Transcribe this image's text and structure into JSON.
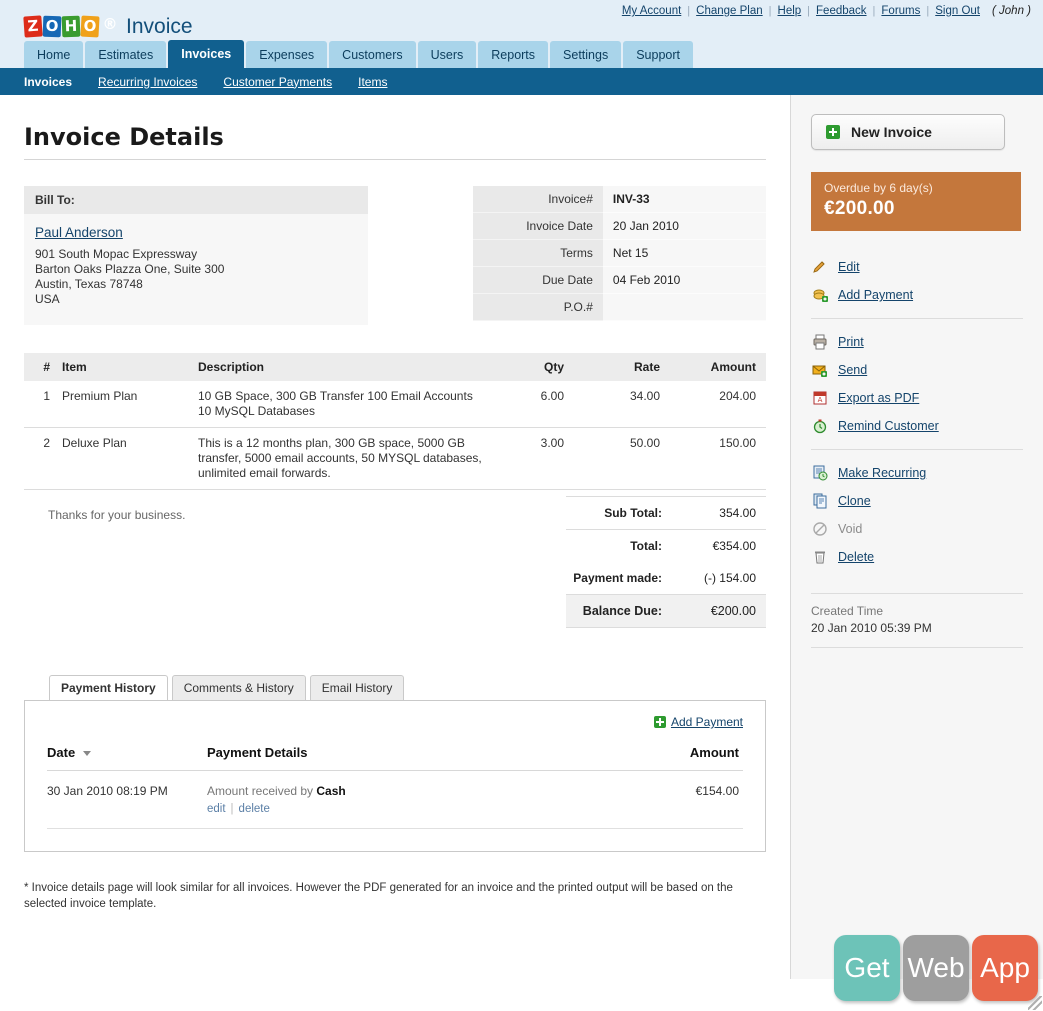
{
  "header": {
    "logo": {
      "tiles": [
        "Z",
        "O",
        "H",
        "O"
      ],
      "reg": "®",
      "word": "Invoice"
    },
    "top_links": [
      {
        "label": "My Account"
      },
      {
        "label": "Change Plan"
      },
      {
        "label": "Help"
      },
      {
        "label": "Feedback"
      },
      {
        "label": "Forums"
      },
      {
        "label": "Sign Out"
      }
    ],
    "user": "( John )",
    "tabs": [
      {
        "label": "Home",
        "active": false
      },
      {
        "label": "Estimates",
        "active": false
      },
      {
        "label": "Invoices",
        "active": true
      },
      {
        "label": "Expenses",
        "active": false
      },
      {
        "label": "Customers",
        "active": false
      },
      {
        "label": "Users",
        "active": false
      },
      {
        "label": "Reports",
        "active": false
      },
      {
        "label": "Settings",
        "active": false
      },
      {
        "label": "Support",
        "active": false
      }
    ],
    "subnav": [
      {
        "label": "Invoices",
        "active": true
      },
      {
        "label": "Recurring Invoices",
        "active": false
      },
      {
        "label": "Customer Payments",
        "active": false
      },
      {
        "label": "Items",
        "active": false
      }
    ]
  },
  "main": {
    "page_title": "Invoice Details",
    "bill_to": {
      "heading": "Bill To:",
      "customer": "Paul Anderson",
      "address_lines": [
        "901 South Mopac Expressway",
        "Barton Oaks Plazza One, Suite 300",
        "Austin, Texas 78748",
        "USA"
      ]
    },
    "meta": [
      {
        "key": "Invoice#",
        "value": "INV-33",
        "strong": true
      },
      {
        "key": "Invoice Date",
        "value": "20 Jan 2010",
        "strong": false
      },
      {
        "key": "Terms",
        "value": "Net 15",
        "strong": false
      },
      {
        "key": "Due Date",
        "value": "04 Feb 2010",
        "strong": false
      },
      {
        "key": "P.O.#",
        "value": "",
        "strong": false
      }
    ],
    "items_header": [
      "#",
      "Item",
      "Description",
      "Qty",
      "Rate",
      "Amount"
    ],
    "items": [
      {
        "num": "1",
        "item": "Premium Plan",
        "description": "10 GB Space, 300 GB Transfer 100 Email Accounts 10 MySQL Databases",
        "qty": "6.00",
        "rate": "34.00",
        "amount": "204.00"
      },
      {
        "num": "2",
        "item": "Deluxe Plan",
        "description": "This is a 12 months plan, 300 GB space, 5000 GB transfer, 5000 email accounts, 50 MYSQL databases, unlimited email forwards.",
        "qty": "3.00",
        "rate": "50.00",
        "amount": "150.00"
      }
    ],
    "thanks_note": "Thanks for your business.",
    "totals": [
      {
        "key": "Sub Total:",
        "value": "354.00"
      },
      {
        "key": "Total:",
        "value": "€354.00"
      },
      {
        "key": "Payment made:",
        "value": "(-) 154.00"
      },
      {
        "key": "Balance Due:",
        "value": "€200.00"
      }
    ],
    "panel_tabs": [
      {
        "label": "Payment History",
        "active": true
      },
      {
        "label": "Comments & History",
        "active": false
      },
      {
        "label": "Email History",
        "active": false
      }
    ],
    "add_payment_label": "Add Payment",
    "payment_table": {
      "headers": [
        "Date",
        "Payment Details",
        "Amount"
      ],
      "rows": [
        {
          "date": "30 Jan 2010 08:19 PM",
          "details_prefix": "Amount received by ",
          "details_method": "Cash",
          "edit": "edit",
          "delete": "delete",
          "amount": "€154.00"
        }
      ]
    },
    "footnote": "* Invoice details page will look similar for all invoices. However the PDF generated for an invoice and the printed output will be based on the selected invoice template."
  },
  "sidebar": {
    "new_invoice_label": "New Invoice",
    "status": {
      "line1": "Overdue by 6 day(s)",
      "line2": "€200.00"
    },
    "actions_group1": [
      {
        "label": "Edit",
        "icon": "pencil-icon",
        "disabled": false
      },
      {
        "label": "Add Payment",
        "icon": "money-add-icon",
        "disabled": false
      }
    ],
    "actions_group2": [
      {
        "label": "Print",
        "icon": "printer-icon",
        "disabled": false
      },
      {
        "label": "Send",
        "icon": "envelope-icon",
        "disabled": false
      },
      {
        "label": "Export as PDF",
        "icon": "pdf-icon",
        "disabled": false
      },
      {
        "label": "Remind Customer",
        "icon": "clock-icon",
        "disabled": false
      }
    ],
    "actions_group3": [
      {
        "label": "Make Recurring",
        "icon": "recurring-icon",
        "disabled": false
      },
      {
        "label": "Clone",
        "icon": "copy-icon",
        "disabled": false
      },
      {
        "label": "Void",
        "icon": "void-icon",
        "disabled": true
      },
      {
        "label": "Delete",
        "icon": "trash-icon",
        "disabled": false
      }
    ],
    "created": {
      "label": "Created Time",
      "value": "20 Jan 2010 05:39 PM"
    }
  },
  "badge": {
    "words": [
      "Get",
      "Web",
      "App"
    ],
    "colors": [
      "#6dc3b8",
      "#9e9e9e",
      "#e8674a"
    ]
  },
  "colors": {
    "brand_blue": "#11608f",
    "tab_blue": "#a9d4ea",
    "header_bg": "#e3eef7",
    "overdue": "#c4773c",
    "link": "#14446b",
    "green": "#2e9b30"
  }
}
